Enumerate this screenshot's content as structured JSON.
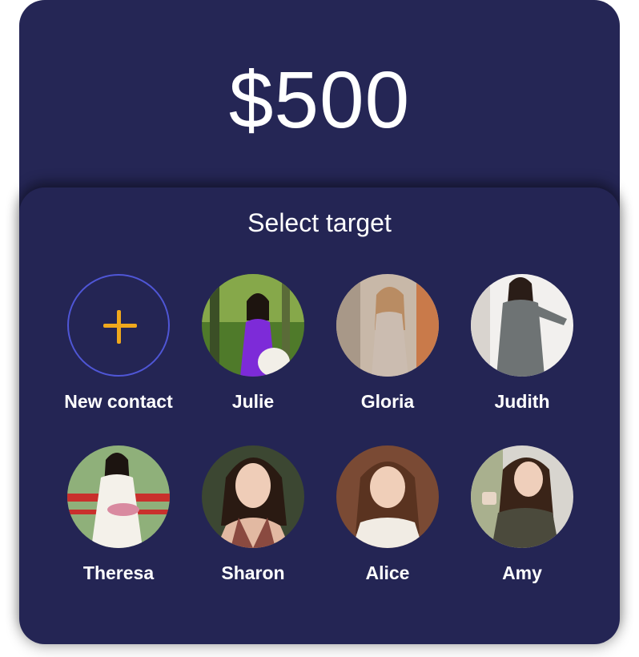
{
  "amount": {
    "value": "$500"
  },
  "target": {
    "title": "Select target",
    "new_contact_label": "New contact",
    "contacts": [
      {
        "name": "Julie"
      },
      {
        "name": "Gloria"
      },
      {
        "name": "Judith"
      },
      {
        "name": "Theresa"
      },
      {
        "name": "Sharon"
      },
      {
        "name": "Alice"
      },
      {
        "name": "Amy"
      }
    ]
  },
  "colors": {
    "card_background": "#252655",
    "accent_plus": "#f0a81c",
    "new_contact_ring": "#4f56d6",
    "text": "#ffffff"
  },
  "icons": {
    "add": "plus-icon"
  }
}
